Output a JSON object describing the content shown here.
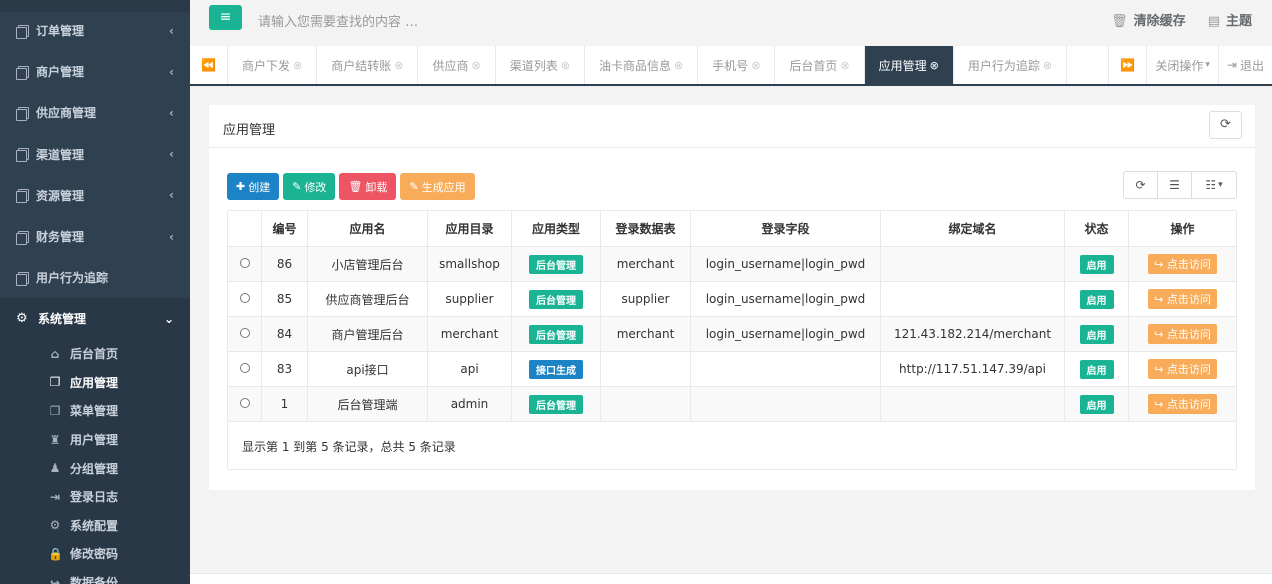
{
  "sidebar": {
    "items": [
      {
        "label": "订单管理",
        "arrow": "‹"
      },
      {
        "label": "商户管理",
        "arrow": "‹"
      },
      {
        "label": "供应商管理",
        "arrow": "‹"
      },
      {
        "label": "渠道管理",
        "arrow": "‹"
      },
      {
        "label": "资源管理",
        "arrow": "‹"
      },
      {
        "label": "财务管理",
        "arrow": "‹"
      },
      {
        "label": "用户行为追踪",
        "arrow": ""
      }
    ],
    "active_group": {
      "label": "系统管理",
      "arrow": "⌄"
    },
    "sub_items": [
      {
        "label": "后台首页",
        "icon": "home-icon"
      },
      {
        "label": "应用管理",
        "icon": "copy-icon"
      },
      {
        "label": "菜单管理",
        "icon": "copy-icon"
      },
      {
        "label": "用户管理",
        "icon": "user-secret-icon"
      },
      {
        "label": "分组管理",
        "icon": "user-icon"
      },
      {
        "label": "登录日志",
        "icon": "sign-in-icon"
      },
      {
        "label": "系统配置",
        "icon": "gear-icon"
      },
      {
        "label": "修改密码",
        "icon": "lock-icon"
      },
      {
        "label": "数据备份",
        "icon": "share-icon"
      }
    ]
  },
  "topbar": {
    "menu_icon": "≡",
    "search_placeholder": "请输入您需要查找的内容 …",
    "clear_cache": "清除缓存",
    "theme": "主题"
  },
  "tabs": {
    "items": [
      "商户下发",
      "商户结转账",
      "供应商",
      "渠道列表",
      "油卡商品信息",
      "手机号",
      "后台首页",
      "应用管理",
      "用户行为追踪"
    ],
    "active_index": 7,
    "close_ops": "关闭操作",
    "logout": "退出"
  },
  "panel": {
    "title": "应用管理",
    "toolbar": {
      "create": "创建",
      "edit": "修改",
      "delete": "卸载",
      "generate": "生成应用"
    },
    "columns": [
      "",
      "编号",
      "应用名",
      "应用目录",
      "应用类型",
      "登录数据表",
      "登录字段",
      "绑定域名",
      "状态",
      "操作"
    ],
    "rows": [
      {
        "id": "86",
        "name": "小店管理后台",
        "dir": "smallshop",
        "type": "后台管理",
        "type_style": "primary",
        "table": "merchant",
        "field": "login_username|login_pwd",
        "domain": "",
        "status": "启用",
        "action": "点击访问"
      },
      {
        "id": "85",
        "name": "供应商管理后台",
        "dir": "supplier",
        "type": "后台管理",
        "type_style": "primary",
        "table": "supplier",
        "field": "login_username|login_pwd",
        "domain": "",
        "status": "启用",
        "action": "点击访问"
      },
      {
        "id": "84",
        "name": "商户管理后台",
        "dir": "merchant",
        "type": "后台管理",
        "type_style": "primary",
        "table": "merchant",
        "field": "login_username|login_pwd",
        "domain": "121.43.182.214/merchant",
        "status": "启用",
        "action": "点击访问"
      },
      {
        "id": "83",
        "name": "api接口",
        "dir": "api",
        "type": "接口生成",
        "type_style": "info",
        "table": "",
        "field": "",
        "domain": "http://117.51.147.39/api",
        "status": "启用",
        "action": "点击访问"
      },
      {
        "id": "1",
        "name": "后台管理端",
        "dir": "admin",
        "type": "后台管理",
        "type_style": "primary",
        "table": "",
        "field": "",
        "domain": "",
        "status": "启用",
        "action": "点击访问"
      }
    ],
    "pager_text": "显示第 1 到第 5 条记录，总共 5 条记录"
  },
  "colors": {
    "sidebar_bg": "#2f4050",
    "primary": "#1ab394",
    "info": "#1c84c6",
    "danger": "#ed5565",
    "warning": "#f8ac59"
  }
}
